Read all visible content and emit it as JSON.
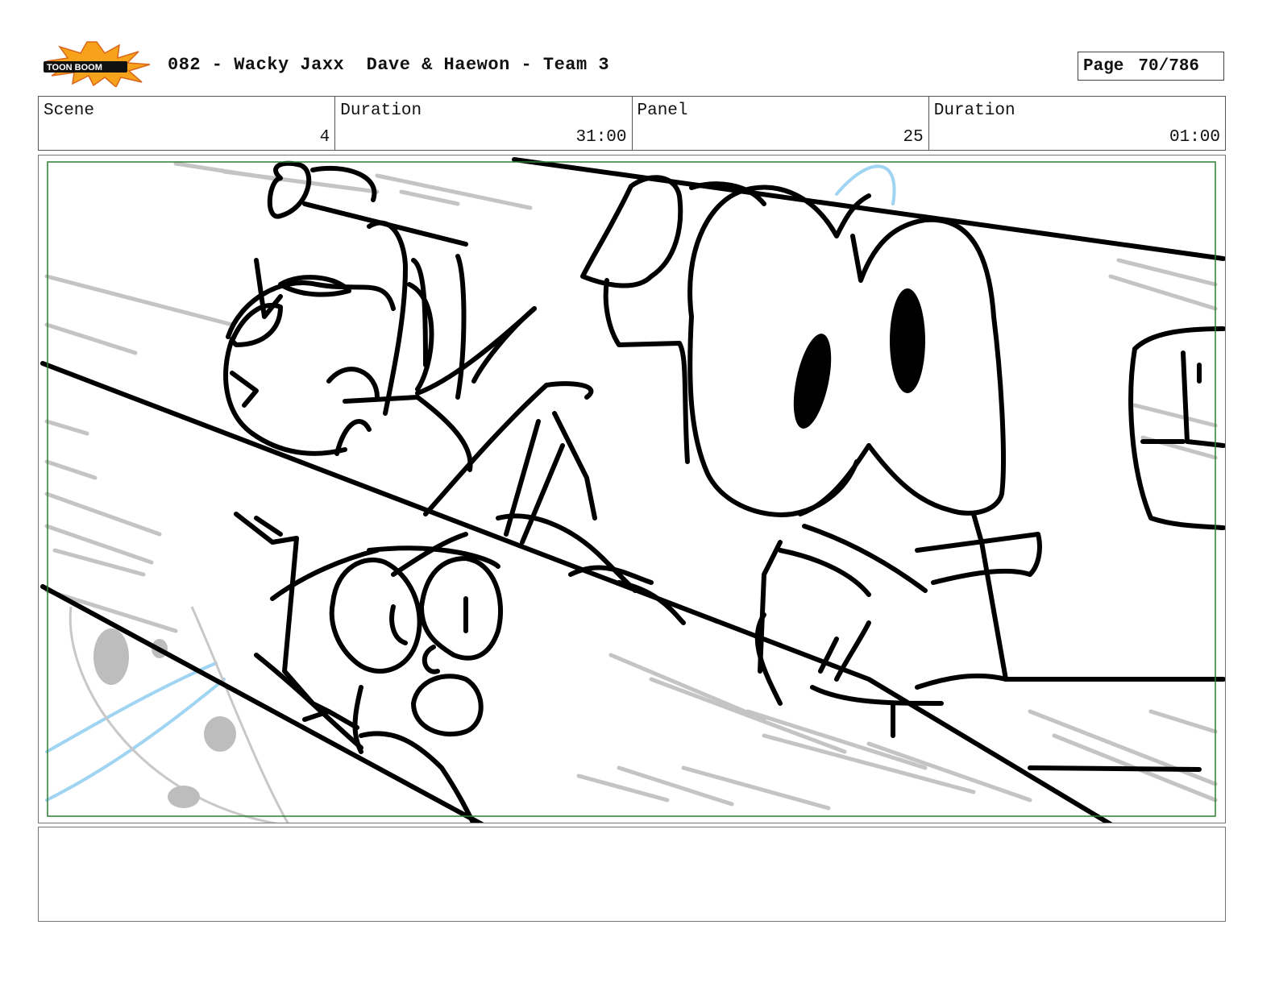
{
  "header": {
    "logo_text": "TOON BOOM",
    "title": "082 - Wacky Jaxx  Dave & Haewon - Team 3",
    "page_label": "Page",
    "page_number": "70/786"
  },
  "info": {
    "scene_label": "Scene",
    "scene_value": "4",
    "scene_duration_label": "Duration",
    "scene_duration_value": "31:00",
    "panel_label": "Panel",
    "panel_value": "25",
    "panel_duration_label": "Duration",
    "panel_duration_value": "01:00"
  },
  "notes": {
    "text": ""
  },
  "colors": {
    "safe_frame": "#2e7d32",
    "sketch_ink": "#000000",
    "speed_lines": "#c4c4c4",
    "blue_lines": "#9fd4f2",
    "logo_orange": "#f7a21b"
  }
}
